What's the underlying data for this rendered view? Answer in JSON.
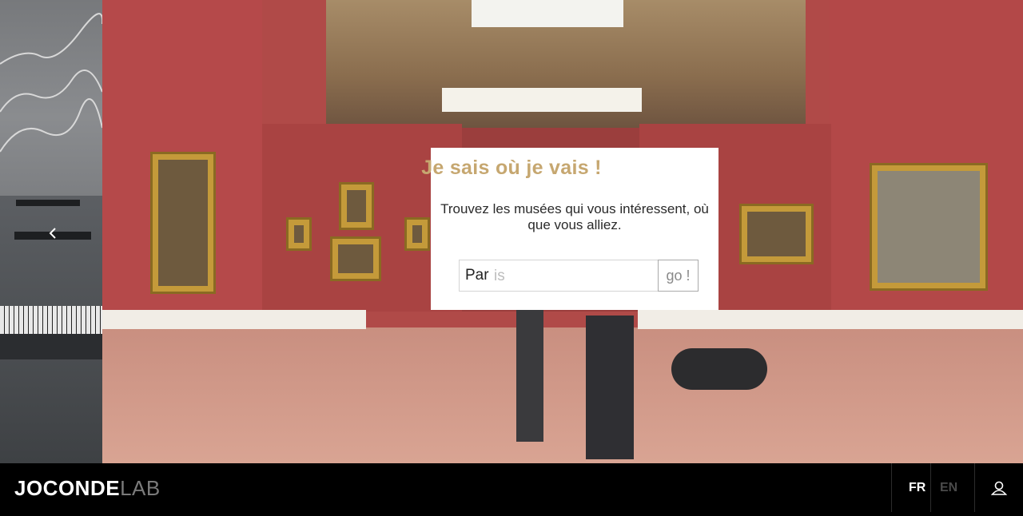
{
  "hero": {
    "title": "Je sais où je vais !",
    "text": "Trouvez les musées qui vous intéressent, où que vous alliez.",
    "search": {
      "value": "Par",
      "suggestion_suffix": "is"
    },
    "go_label": "go !"
  },
  "carousel": {
    "prev_icon": "chevron-left-icon"
  },
  "footer": {
    "logo_bold": "JOCONDE",
    "logo_light": "LAB",
    "languages": [
      {
        "code": "FR",
        "active": true
      },
      {
        "code": "EN",
        "active": false
      }
    ],
    "user_icon": "user-icon"
  },
  "colors": {
    "accent_gold": "#c6a770",
    "footer_bg": "#000000",
    "gallery_red": "#b04a48"
  }
}
